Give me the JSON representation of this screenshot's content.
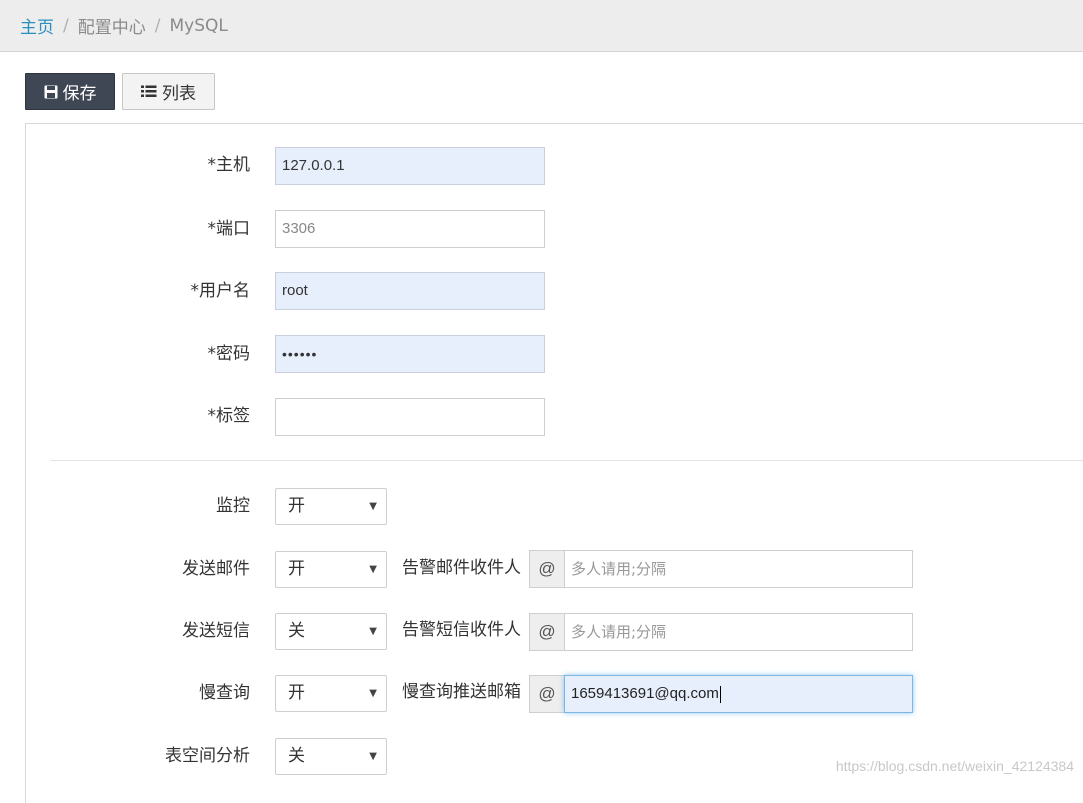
{
  "breadcrumb": {
    "home": "主页",
    "sep": "/",
    "config": "配置中心",
    "current": "MySQL"
  },
  "toolbar": {
    "save_label": "保存",
    "list_label": "列表"
  },
  "form": {
    "host": {
      "label": "*主机",
      "value": "127.0.0.1"
    },
    "port": {
      "label": "*端口",
      "placeholder": "3306"
    },
    "username": {
      "label": "*用户名",
      "value": "root"
    },
    "password": {
      "label": "*密码",
      "value": "••••••"
    },
    "tag": {
      "label": "*标签",
      "value": ""
    },
    "monitor": {
      "label": "监控",
      "value": "开"
    },
    "send_email": {
      "label": "发送邮件",
      "value": "开",
      "recipients_label": "告警邮件收件人",
      "addon": "@",
      "placeholder": "多人请用;分隔"
    },
    "send_sms": {
      "label": "发送短信",
      "value": "关",
      "recipients_label": "告警短信收件人",
      "addon": "@",
      "placeholder": "多人请用;分隔"
    },
    "slow_query": {
      "label": "慢查询",
      "value": "开",
      "email_label": "慢查询推送邮箱",
      "addon": "@",
      "value_email": "1659413691@qq.com"
    },
    "tablespace": {
      "label": "表空间分析",
      "value": "关"
    }
  },
  "select_caret": "▼",
  "watermark": "https://blog.csdn.net/weixin_42124384"
}
